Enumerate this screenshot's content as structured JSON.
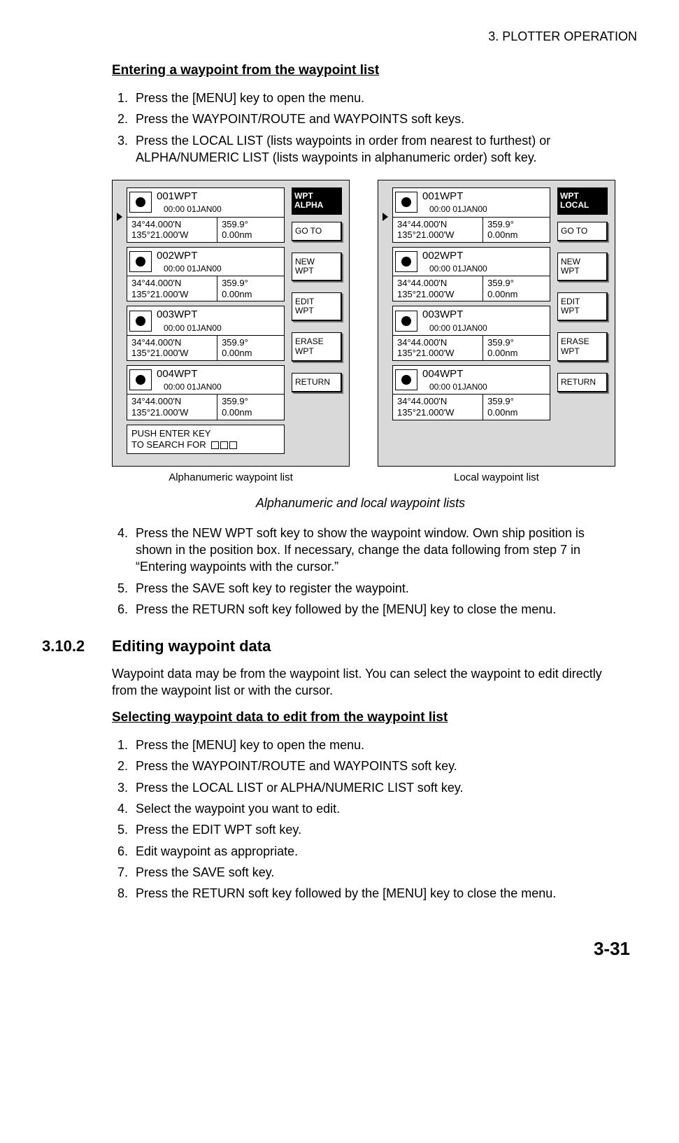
{
  "header_chapter": "3. PLOTTER OPERATION",
  "heading1": "Entering a waypoint from the waypoint list",
  "stepsA": [
    "Press the [MENU] key to open the menu.",
    "Press the WAYPOINT/ROUTE and WAYPOINTS soft keys.",
    "Press the LOCAL LIST (lists waypoints in order from nearest to furthest) or ALPHA/NUMERIC LIST (lists waypoints in alphanumeric order) soft key."
  ],
  "waypoints": [
    {
      "name": "001WPT",
      "time": "00:00 01JAN00",
      "lat": "34°44.000'N",
      "lon": "135°21.000'W",
      "brg": "359.9°",
      "dist": "0.00nm"
    },
    {
      "name": "002WPT",
      "time": "00:00 01JAN00",
      "lat": "34°44.000'N",
      "lon": "135°21.000'W",
      "brg": "359.9°",
      "dist": "0.00nm"
    },
    {
      "name": "003WPT",
      "time": "00:00 01JAN00",
      "lat": "34°44.000'N",
      "lon": "135°21.000'W",
      "brg": "359.9°",
      "dist": "0.00nm"
    },
    {
      "name": "004WPT",
      "time": "00:00 01JAN00",
      "lat": "34°44.000'N",
      "lon": "135°21.000'W",
      "brg": "359.9°",
      "dist": "0.00nm"
    }
  ],
  "search_line1": "PUSH ENTER KEY",
  "search_line2": "TO SEARCH FOR",
  "mode_alpha_l1": "WPT",
  "mode_alpha_l2": "ALPHA",
  "mode_local_l1": "WPT",
  "mode_local_l2": "LOCAL",
  "sk_goto": "GO TO",
  "sk_new_l1": "NEW",
  "sk_new_l2": "WPT",
  "sk_edit_l1": "EDIT",
  "sk_edit_l2": "WPT",
  "sk_erase_l1": "ERASE",
  "sk_erase_l2": "WPT",
  "sk_return": "RETURN",
  "fig_label_left": "Alphanumeric waypoint list",
  "fig_label_right": "Local waypoint list",
  "fig_caption": "Alphanumeric and local waypoint lists",
  "stepsB": [
    "Press the NEW WPT soft key to show the waypoint window. Own ship position is shown in the position box. If necessary, change the data following from step 7 in “Entering waypoints with the cursor.”",
    "Press the SAVE soft key to register the waypoint.",
    " Press the RETURN soft key followed by the [MENU] key to close the menu."
  ],
  "section_number": "3.10.2",
  "section_title": "Editing waypoint data",
  "section_intro": "Waypoint data may be from the waypoint list. You can select the waypoint to edit directly from the waypoint list or with the cursor.",
  "heading2": "Selecting waypoint data to edit from the waypoint list",
  "stepsC": [
    "Press the [MENU] key to open the menu.",
    "Press the WAYPOINT/ROUTE and WAYPOINTS soft key.",
    "Press the LOCAL LIST or ALPHA/NUMERIC LIST soft key.",
    "Select the waypoint you want to edit.",
    "Press the EDIT WPT soft key.",
    "Edit waypoint as appropriate.",
    "Press the SAVE soft key.",
    "Press the RETURN soft key followed by the [MENU] key to close the menu."
  ],
  "page_number": "3-31"
}
